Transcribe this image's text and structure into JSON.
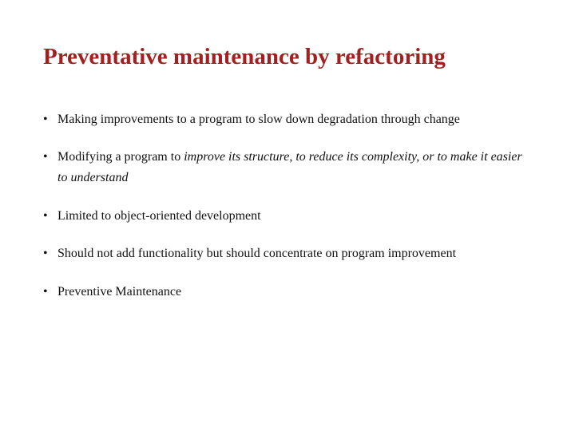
{
  "slide": {
    "title": "Preventative maintenance by refactoring",
    "bullets": [
      {
        "parts": [
          {
            "text": "Making improvements to a program to slow down degradation through change",
            "italic": false
          }
        ]
      },
      {
        "parts": [
          {
            "text": "Modifying a program to ",
            "italic": false
          },
          {
            "text": "improve its structure, to reduce its complexity, or to make it easier to understand",
            "italic": true
          }
        ]
      },
      {
        "parts": [
          {
            "text": "Limited to object-oriented development",
            "italic": false
          }
        ]
      },
      {
        "parts": [
          {
            "text": "Should not add functionality but should concentrate on program improvement",
            "italic": false
          }
        ]
      },
      {
        "parts": [
          {
            "text": "Preventive Maintenance",
            "italic": false
          }
        ]
      }
    ]
  }
}
